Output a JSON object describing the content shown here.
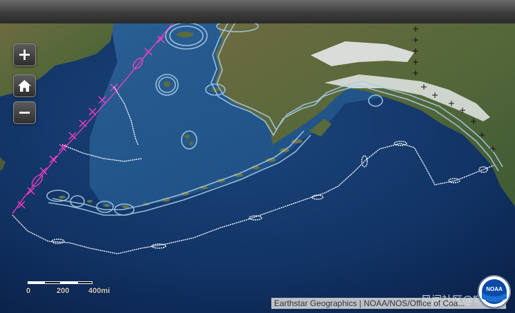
{
  "toolbar": {},
  "controls": {
    "zoom_in_label": "+",
    "home_icon": "home-icon",
    "zoom_out_label": "−"
  },
  "scalebar": {
    "labels": [
      "0",
      "200",
      "400mi"
    ]
  },
  "attribution": {
    "text": "Earthstar Geographics | NOAA/NOS/Office of Coa..."
  },
  "watermark": {
    "text": "风闻社区@穹枫"
  },
  "logo": {
    "text": "NOAA"
  },
  "map": {
    "basemap": "satellite imagery",
    "colors": {
      "ocean_deep": "#0b2550",
      "ocean_shelf": "#1e4f86",
      "land": "#5f6b3f",
      "snow": "#eef1f4",
      "track_pink": "#ff3cc8",
      "track_white": "#ffffff",
      "boundary_outline": "#9fc3e0"
    }
  }
}
